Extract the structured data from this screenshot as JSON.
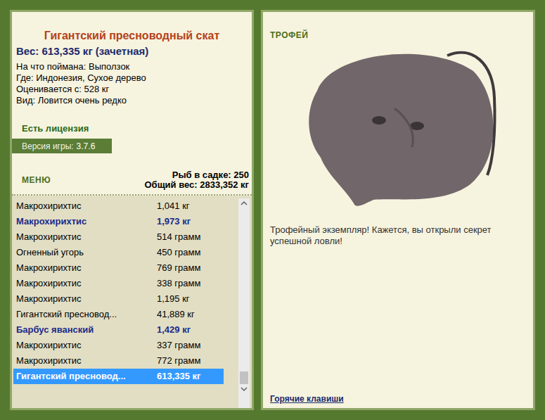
{
  "fish": {
    "name": "Гигантский пресноводный скат",
    "weight": "Вес: 613,335 кг (зачетная)",
    "details": [
      "На что поймана: Выползок",
      "Где: Индонезия, Сухое дерево",
      "Оценивается с: 528 кг",
      "Вид: Ловится очень редко"
    ]
  },
  "license": "Есть лицензия",
  "version": {
    "label": "Версия игры:",
    "value": "3.7.6"
  },
  "menu": "МЕНЮ",
  "keepnet": {
    "count": "Рыб в садке: 250",
    "total": "Общий вес: 2833,352 кг"
  },
  "catches": [
    {
      "name": "Макрохирихтис",
      "weight": "1,041 кг",
      "trophy": false,
      "selected": false
    },
    {
      "name": "Макрохирихтис",
      "weight": "1,973 кг",
      "trophy": true,
      "selected": false
    },
    {
      "name": "Макрохирихтис",
      "weight": "514 грамм",
      "trophy": false,
      "selected": false
    },
    {
      "name": "Огненный угорь",
      "weight": "450 грамм",
      "trophy": false,
      "selected": false
    },
    {
      "name": "Макрохирихтис",
      "weight": "769 грамм",
      "trophy": false,
      "selected": false
    },
    {
      "name": "Макрохирихтис",
      "weight": "338 грамм",
      "trophy": false,
      "selected": false
    },
    {
      "name": "Макрохирихтис",
      "weight": "1,195 кг",
      "trophy": false,
      "selected": false
    },
    {
      "name": "Гигантский пресновод...",
      "weight": "41,889 кг",
      "trophy": false,
      "selected": false
    },
    {
      "name": "Барбус яванский",
      "weight": "1,429 кг",
      "trophy": true,
      "selected": false
    },
    {
      "name": "Макрохирихтис",
      "weight": "337 грамм",
      "trophy": false,
      "selected": false
    },
    {
      "name": "Макрохирихтис",
      "weight": "772 грамм",
      "trophy": false,
      "selected": false
    },
    {
      "name": "Гигантский пресновод...",
      "weight": "613,335 кг",
      "trophy": true,
      "selected": true
    }
  ],
  "scroll": {
    "level": 1
  },
  "trophy": {
    "label": "ТРОФЕЙ",
    "message": "Трофейный экземпляр! Кажется, вы открыли секрет успешной ловли!",
    "hotkeys": "Горячие клавиши"
  }
}
